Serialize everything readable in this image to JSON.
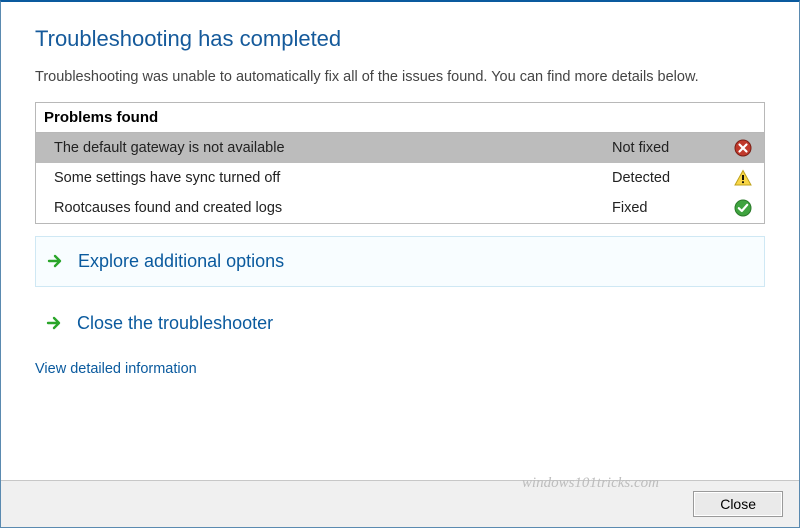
{
  "title": "Troubleshooting has completed",
  "description": "Troubleshooting was unable to automatically fix all of the issues found. You can find more details below.",
  "problems": {
    "header": "Problems found",
    "rows": [
      {
        "name": "The default gateway is not available",
        "status": "Not fixed",
        "icon": "error",
        "highlight": true
      },
      {
        "name": "Some settings have sync turned off",
        "status": "Detected",
        "icon": "warning",
        "highlight": false
      },
      {
        "name": "Rootcauses found and created logs",
        "status": "Fixed",
        "icon": "success",
        "highlight": false
      }
    ]
  },
  "options": {
    "explore": "Explore additional options",
    "close_ts": "Close the troubleshooter"
  },
  "link": {
    "detailed": "View detailed information"
  },
  "footer": {
    "close": "Close",
    "watermark": "windows101tricks.com"
  }
}
